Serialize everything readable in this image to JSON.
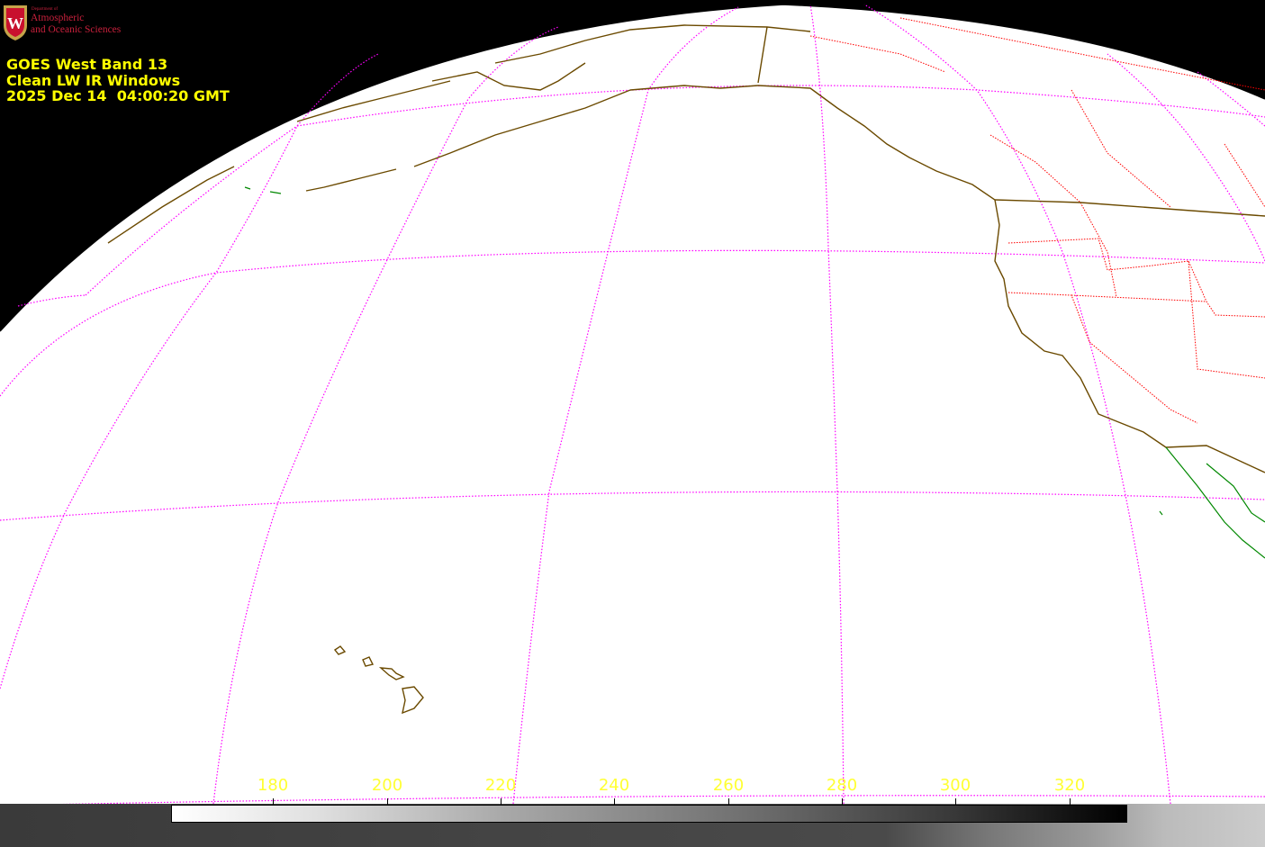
{
  "logo": {
    "dept_small": "Department of",
    "line1": "Atmospheric",
    "line2": "and Oceanic Sciences",
    "crest_letter": "W"
  },
  "title": {
    "line1": "GOES West Band 13",
    "line2": "Clean LW IR Windows",
    "line3": "2025 Dec 14  04:00:20 GMT"
  },
  "colorbar": {
    "ticks": [
      "180",
      "200",
      "220",
      "240",
      "260",
      "280",
      "300",
      "320"
    ],
    "gradient": "white-to-black"
  },
  "colors": {
    "graticule": "#ff00ff",
    "coastline": "#6b4a00",
    "borders": "#ff0000",
    "mexico_coast": "#008800",
    "label": "#ffff00"
  }
}
